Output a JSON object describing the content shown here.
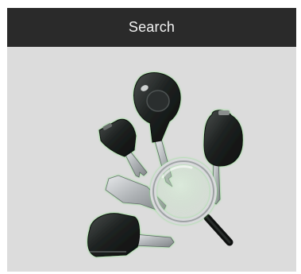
{
  "header": {
    "title": "Search"
  },
  "illustration": {
    "icon": "keys-magnifier-icon"
  },
  "colors": {
    "header_bg": "#2a2a2a",
    "header_text": "#f2f2f2",
    "body_bg": "#dcdcdc",
    "key_dark": "#1b1e1d",
    "metal": "#b9bcbf",
    "glow": "#7be07a"
  }
}
